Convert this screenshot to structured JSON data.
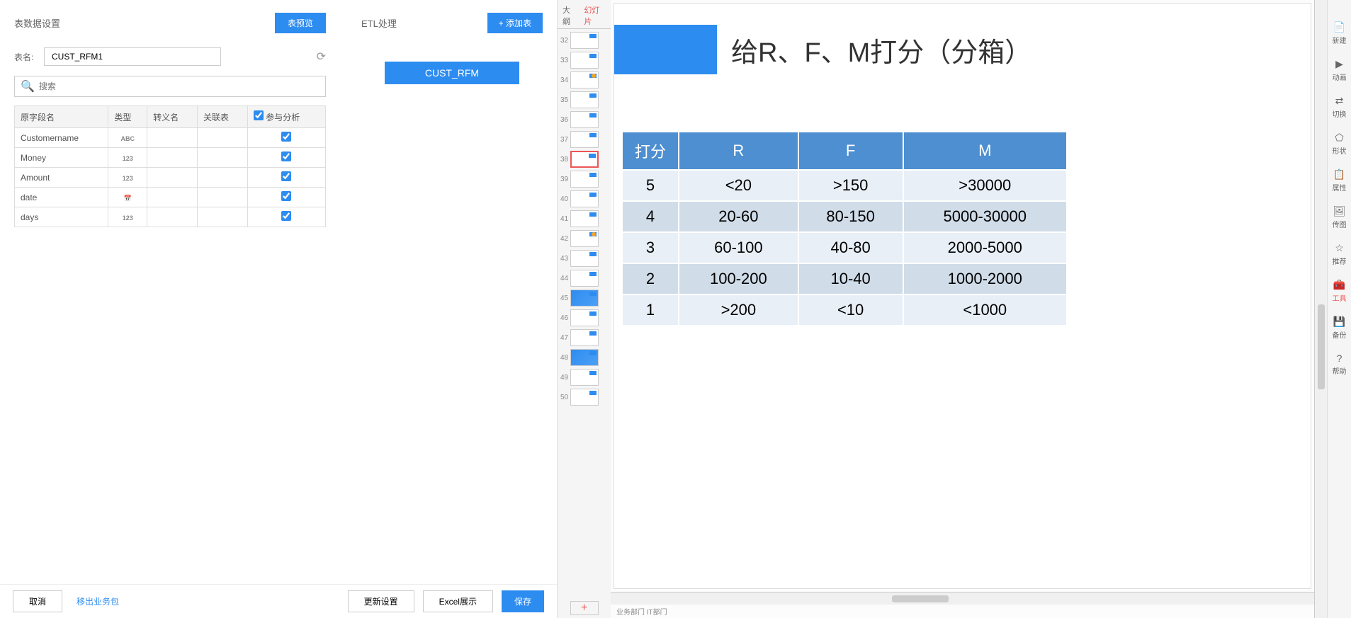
{
  "leftPanel": {
    "title": "表数据设置",
    "previewBtn": "表预览",
    "etlTitle": "ETL处理",
    "addTableBtn": "+ 添加表",
    "tableNameLabel": "表名:",
    "tableName": "CUST_RFM1",
    "searchPlaceholder": "搜索",
    "headers": {
      "field": "原字段名",
      "type": "类型",
      "alias": "转义名",
      "relTable": "关联表",
      "participate": "参与分析"
    },
    "fields": [
      {
        "name": "Customername",
        "type": "ABC",
        "checked": true
      },
      {
        "name": "Money",
        "type": "123",
        "checked": true
      },
      {
        "name": "Amount",
        "type": "123",
        "checked": true
      },
      {
        "name": "date",
        "type": "📅",
        "checked": true
      },
      {
        "name": "days",
        "type": "123",
        "checked": true
      }
    ],
    "etlNode": "CUST_RFM",
    "footer": {
      "cancel": "取消",
      "movePackage": "移出业务包",
      "updateSettings": "更新设置",
      "excelShow": "Excel展示",
      "save": "保存"
    }
  },
  "ppt": {
    "outlineTab": "大纲",
    "slideTab": "幻灯片",
    "slideNumbers": [
      "32",
      "33",
      "34",
      "35",
      "36",
      "37",
      "38",
      "39",
      "40",
      "41",
      "42",
      "43",
      "44",
      "45",
      "46",
      "47",
      "48",
      "49",
      "50"
    ],
    "selectedSlide": "38",
    "slideTitle": "给R、F、M打分（分箱）",
    "scoreHeaders": [
      "打分",
      "R",
      "F",
      "M"
    ],
    "scoreRows": [
      [
        "5",
        "<20",
        ">150",
        ">30000"
      ],
      [
        "4",
        "20-60",
        "80-150",
        "5000-30000"
      ],
      [
        "3",
        "60-100",
        "40-80",
        "2000-5000"
      ],
      [
        "2",
        "100-200",
        "10-40",
        "1000-2000"
      ],
      [
        "1",
        ">200",
        "<10",
        "<1000"
      ]
    ],
    "statusBar": "业务部门   IT部门",
    "tools": [
      {
        "icon": "📄",
        "label": "新建",
        "active": false
      },
      {
        "icon": "▶",
        "label": "动画",
        "active": false
      },
      {
        "icon": "⇄",
        "label": "切换",
        "active": false
      },
      {
        "icon": "⬠",
        "label": "形状",
        "active": false
      },
      {
        "icon": "📋",
        "label": "属性",
        "active": false
      },
      {
        "icon": "🖼",
        "label": "传图",
        "active": false
      },
      {
        "icon": "☆",
        "label": "推荐",
        "active": false
      },
      {
        "icon": "🧰",
        "label": "工具",
        "active": true
      },
      {
        "icon": "💾",
        "label": "备份",
        "active": false
      },
      {
        "icon": "?",
        "label": "帮助",
        "active": false
      }
    ]
  }
}
